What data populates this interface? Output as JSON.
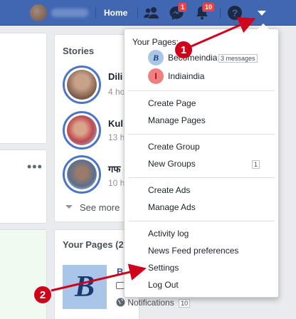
{
  "topbar": {
    "home_label": "Home",
    "messenger_badge": "1",
    "notifications_badge": "10",
    "icons": [
      "friends-icon",
      "messenger-icon",
      "notifications-icon",
      "help-icon",
      "account-menu-icon"
    ]
  },
  "stories": {
    "title": "Stories",
    "items": [
      {
        "name": "Dili",
        "time": "4 ho"
      },
      {
        "name": "Kul",
        "time": "13 h"
      },
      {
        "name": "गफ",
        "time": "10 h"
      }
    ],
    "see_more": "See more"
  },
  "your_pages_section": {
    "title": "Your Pages (2",
    "page_initial": "B",
    "page_name_partial": "B",
    "notifications_label": "Notifications",
    "notifications_count": "10"
  },
  "menu": {
    "header": "Your Pages:",
    "pages": [
      {
        "initial": "B",
        "name": "Becomeindia",
        "badge": "3 messages"
      },
      {
        "initial": "I",
        "name": "Indiaindia"
      }
    ],
    "group1": [
      "Create Page",
      "Manage Pages"
    ],
    "group2": [
      "Create Group",
      "New Groups"
    ],
    "new_groups_count": "1",
    "group3": [
      "Create Ads",
      "Manage Ads"
    ],
    "group4": [
      "Activity log",
      "News Feed preferences",
      "Settings",
      "Log Out"
    ]
  },
  "annotations": {
    "step1": "1",
    "step2": "2"
  },
  "colors": {
    "topbar": "#4267b2",
    "annotation": "#d0021b",
    "notification_badge": "#fa3e3e"
  }
}
